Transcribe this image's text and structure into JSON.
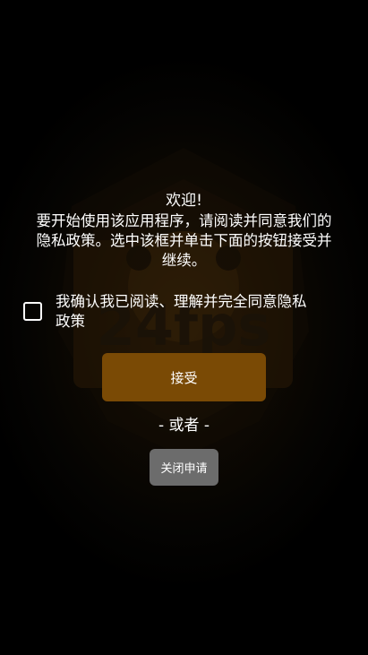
{
  "dialog": {
    "welcome_title": "欢迎!",
    "intro_text": "要开始使用该应用程序，请阅读并同意我们的\n隐私政策。选中该框并单击下面的按钮接受并\n继续。",
    "consent_label": "我确认我已阅读、理解并完全同意隐私\n政策",
    "consent_checked": false,
    "accept_label": "接受",
    "or_text": "- 或者 -",
    "close_label": "关闭申请"
  },
  "background_logo": {
    "icon": "24fps-logo-watermark"
  },
  "colors": {
    "background": "#000000",
    "accept_button": "#7a4a05",
    "close_button": "#6c6c6c",
    "text": "#ffffff"
  }
}
